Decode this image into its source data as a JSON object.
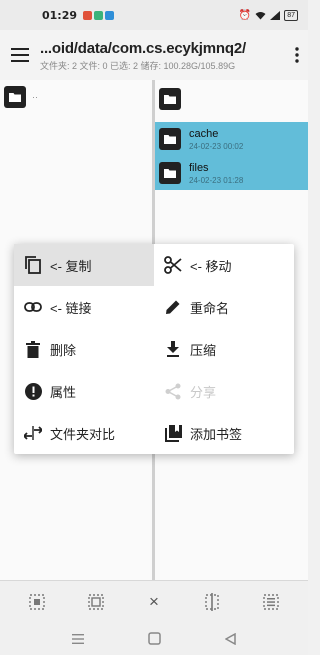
{
  "status_bar": {
    "time": "01:29",
    "battery": "87"
  },
  "app_bar": {
    "path": "...oid/data/com.cs.ecykjmnq2/",
    "info": "文件夹: 2  文件: 0  已选: 2  储存: 100.28G/105.89G"
  },
  "left_pane": {
    "items": [
      {
        "name": "",
        "date": "",
        "dots": "··"
      }
    ]
  },
  "right_pane": {
    "items": [
      {
        "name": "",
        "date": "",
        "selected": false
      },
      {
        "name": "cache",
        "date": "24-02-23 00:02",
        "selected": true
      },
      {
        "name": "files",
        "date": "24-02-23 01:28",
        "selected": true
      }
    ]
  },
  "context_menu": {
    "items": [
      {
        "label": "<- 复制",
        "icon": "copy-icon"
      },
      {
        "label": "<- 移动",
        "icon": "cut-icon"
      },
      {
        "label": "<- 链接",
        "icon": "link-icon"
      },
      {
        "label": "重命名",
        "icon": "pencil-icon"
      },
      {
        "label": "删除",
        "icon": "trash-icon"
      },
      {
        "label": "压缩",
        "icon": "download-icon"
      },
      {
        "label": "属性",
        "icon": "info-icon"
      },
      {
        "label": "分享",
        "icon": "share-icon"
      },
      {
        "label": "文件夹对比",
        "icon": "compare-icon"
      },
      {
        "label": "添加书签",
        "icon": "bookmark-icon"
      }
    ]
  },
  "bottom_bar": {
    "close": "×"
  },
  "colors": {
    "selected_row": "#62bdd9",
    "menu_highlight": "#e2e2e2"
  }
}
